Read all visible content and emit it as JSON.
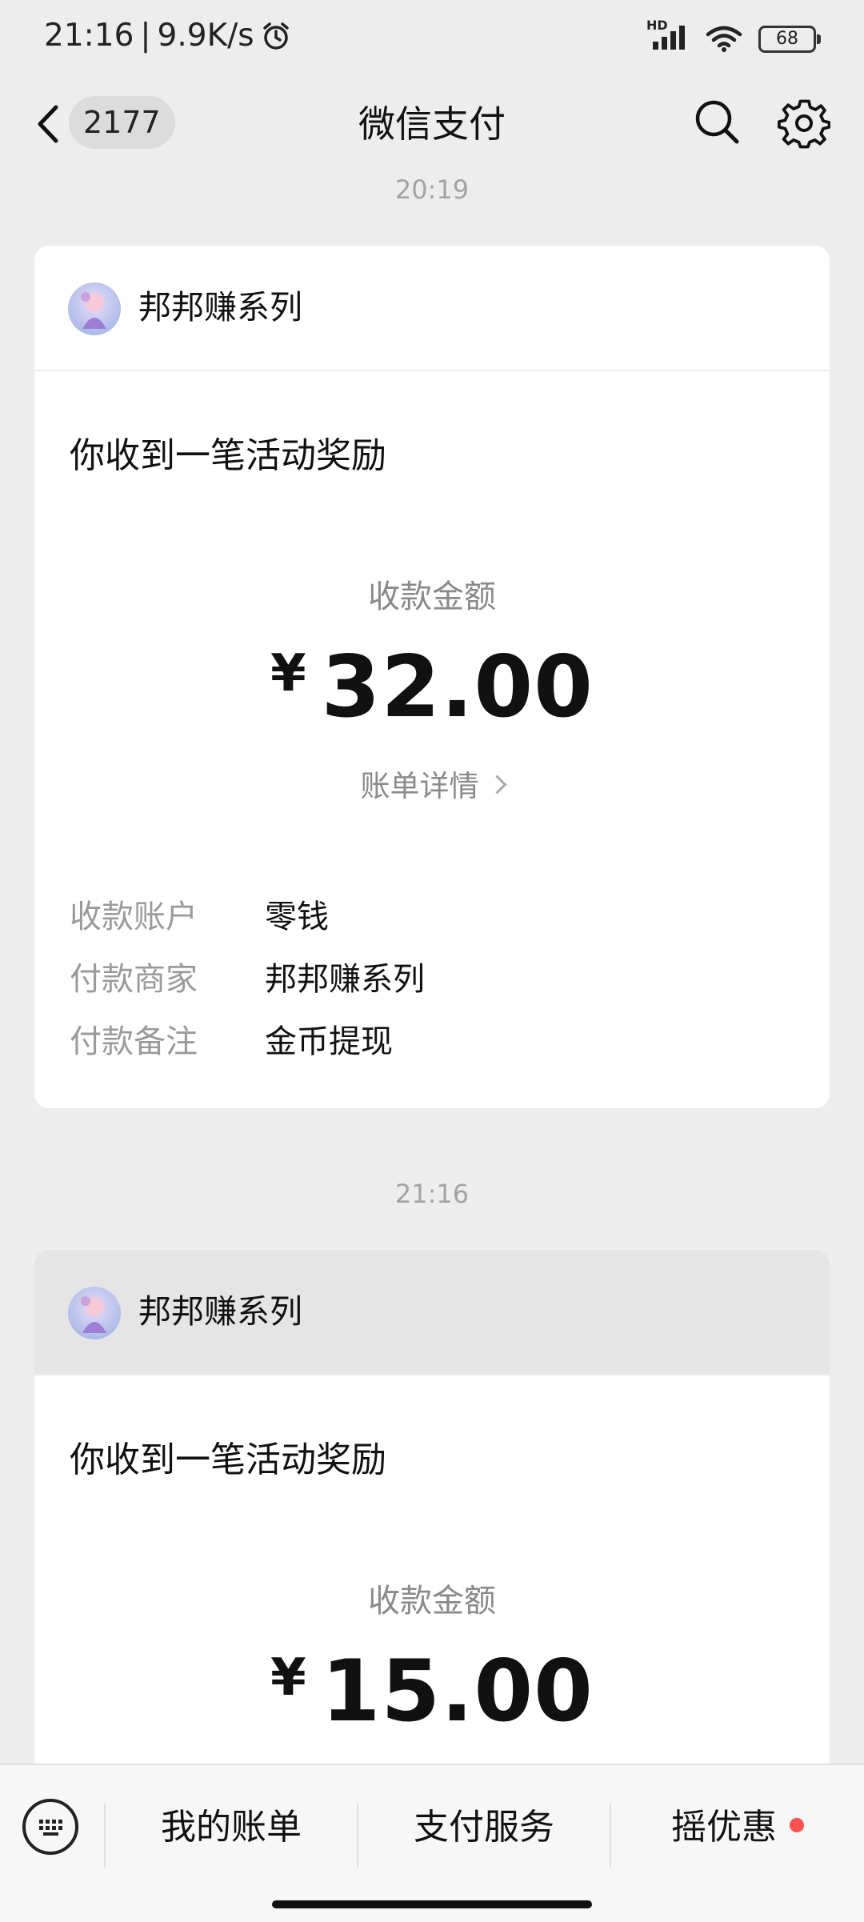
{
  "status_bar": {
    "time": "21:16",
    "speed": "9.9K/s",
    "signal": "HD",
    "battery": "68"
  },
  "nav": {
    "unread_count": "2177",
    "title": "微信支付"
  },
  "messages": [
    {
      "time": "20:19",
      "merchant": "邦邦赚系列",
      "title": "你收到一笔活动奖励",
      "amount_label": "收款金额",
      "currency": "¥",
      "amount": "32.00",
      "bill_link": "账单详情",
      "details": [
        {
          "key": "收款账户",
          "value": "零钱"
        },
        {
          "key": "付款商家",
          "value": "邦邦赚系列"
        },
        {
          "key": "付款备注",
          "value": "金币提现"
        }
      ]
    },
    {
      "time": "21:16",
      "merchant": "邦邦赚系列",
      "title": "你收到一笔活动奖励",
      "amount_label": "收款金额",
      "currency": "¥",
      "amount": "15.00"
    }
  ],
  "bottom_menu": {
    "items": [
      "我的账单",
      "支付服务",
      "摇优惠"
    ]
  },
  "colors": {
    "background": "#ededed",
    "card": "#ffffff",
    "muted_text": "#8a8a8a",
    "red_dot": "#fa5151"
  }
}
